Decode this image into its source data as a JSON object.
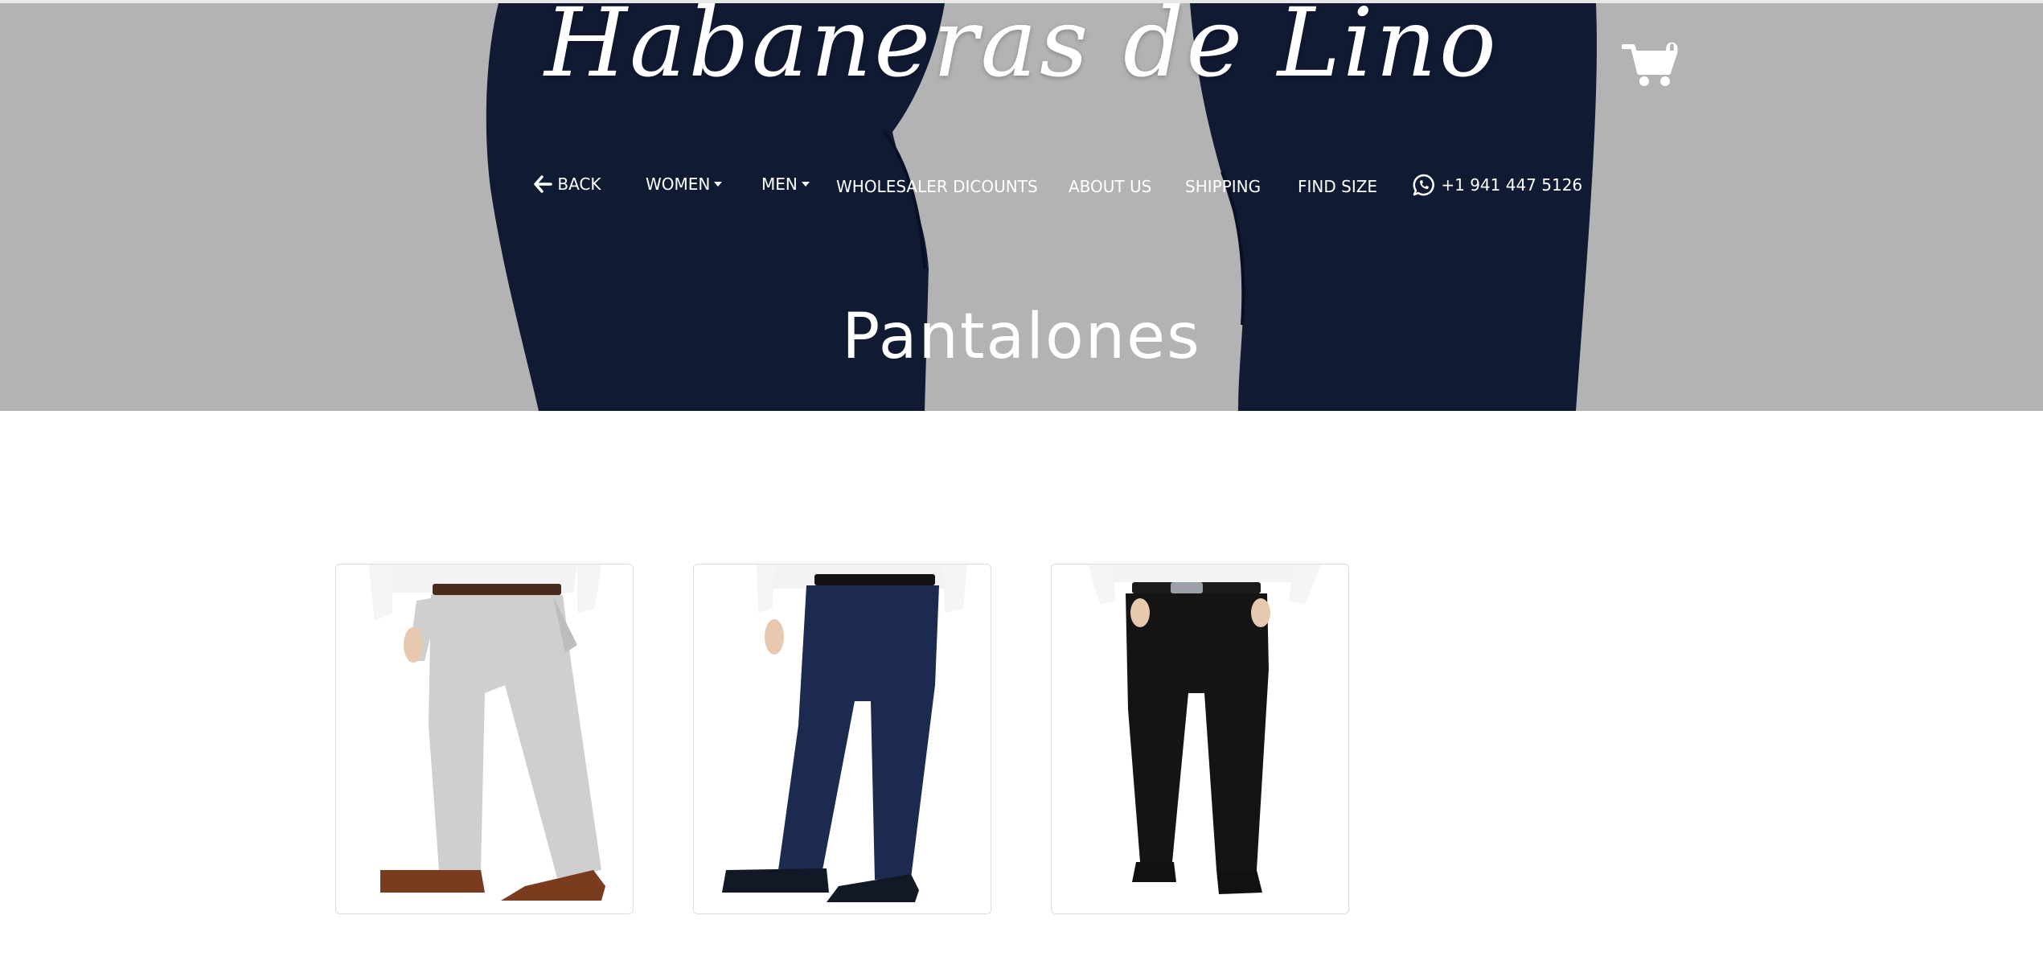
{
  "brand": {
    "name": "Habaneras de Lino"
  },
  "cart": {
    "count": "0",
    "icon": "cart-icon"
  },
  "nav": {
    "back": {
      "label": "BACK",
      "icon": "arrow-left-icon"
    },
    "women": {
      "label": "WOMEN",
      "icon": "caret-down-icon"
    },
    "men": {
      "label": "MEN",
      "icon": "caret-down-icon"
    },
    "wholesaler": {
      "label": "WHOLESALER DICOUNTS"
    },
    "about": {
      "label": "ABOUT US"
    },
    "shipping": {
      "label": "SHIPPING"
    },
    "find_size": {
      "label": "FIND SIZE"
    },
    "phone": {
      "label": "+1 941 447 5126",
      "icon": "whatsapp-icon"
    }
  },
  "page": {
    "title": "Pantalones"
  },
  "products": [
    {
      "image": "light-gray-linen-pants-photo",
      "pants_color": "#cfcfcf"
    },
    {
      "image": "navy-blue-pants-photo",
      "pants_color": "#1c2a4f"
    },
    {
      "image": "black-pants-photo",
      "pants_color": "#141414"
    }
  ],
  "colors": {
    "hero_bg": "#b3b3b3",
    "hero_pants": "#111a33",
    "text_on_hero": "#ffffff"
  }
}
